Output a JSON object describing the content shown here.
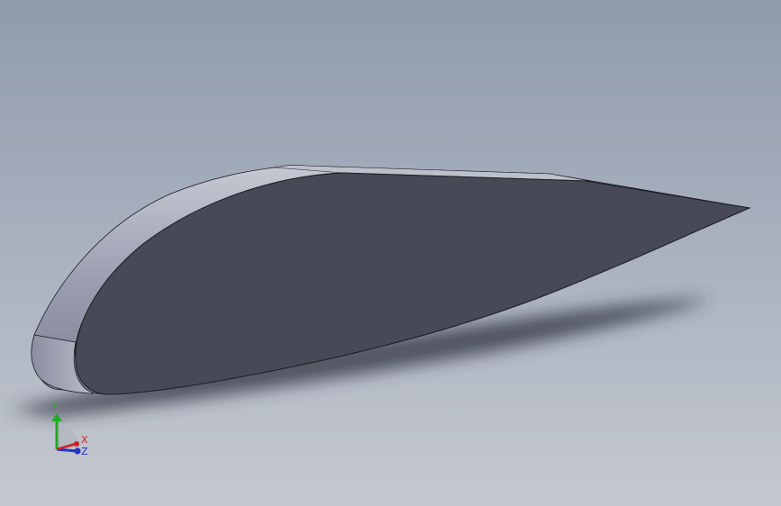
{
  "viewport": {
    "background_top": "#8f9bad",
    "background_bottom": "#c4c8d0"
  },
  "model": {
    "name": "airfoil-extrusion",
    "face_color": "#474a56",
    "side_color": "#9a9eb0",
    "side_highlight": "#c6c9d3",
    "edge_color": "#1a1c22"
  },
  "triad": {
    "axis_y_label": "Y",
    "axis_x_label": "X",
    "axis_z_label": "Z",
    "y_color": "#22aa22",
    "x_color": "#cc2222",
    "z_color": "#2233cc"
  }
}
